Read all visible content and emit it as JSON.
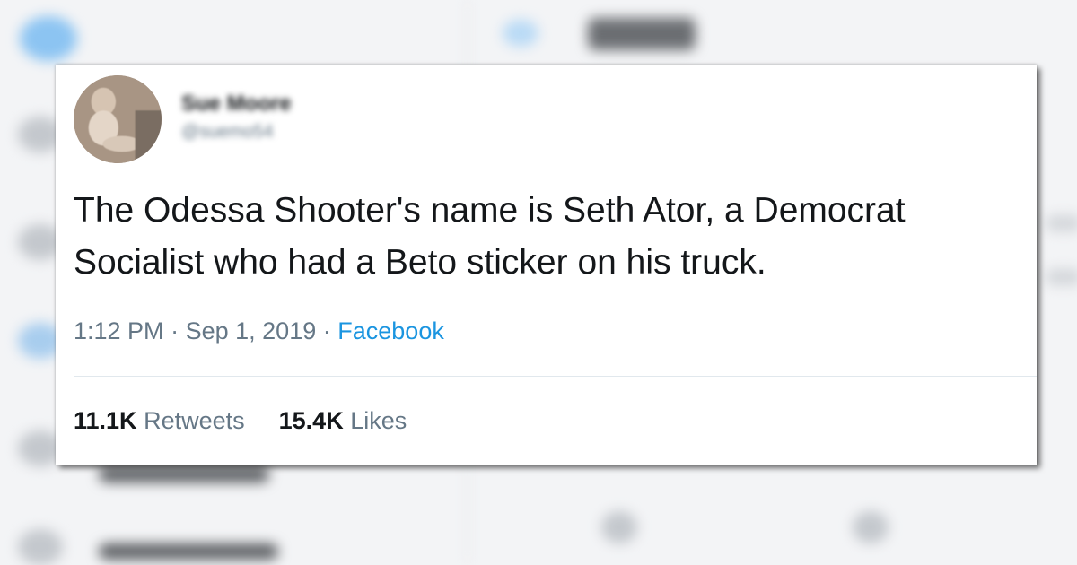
{
  "tweet": {
    "author_name": "Sue Moore",
    "author_handle": "@suemo54",
    "text": "The Odessa Shooter's name is Seth Ator, a Democrat Socialist who had a Beto sticker on his truck.",
    "time": "1:12 PM",
    "separator": "·",
    "date": "Sep 1, 2019",
    "source": "Facebook",
    "retweets_count": "11.1K",
    "retweets_label": "Retweets",
    "likes_count": "15.4K",
    "likes_label": "Likes"
  },
  "colors": {
    "text": "#14171a",
    "secondary": "#657786",
    "link": "#1b95e0",
    "divider": "#e1e8ed"
  },
  "icons": {
    "avatar": "baby-photo-avatar",
    "background_logo": "bird-logo-icon"
  }
}
